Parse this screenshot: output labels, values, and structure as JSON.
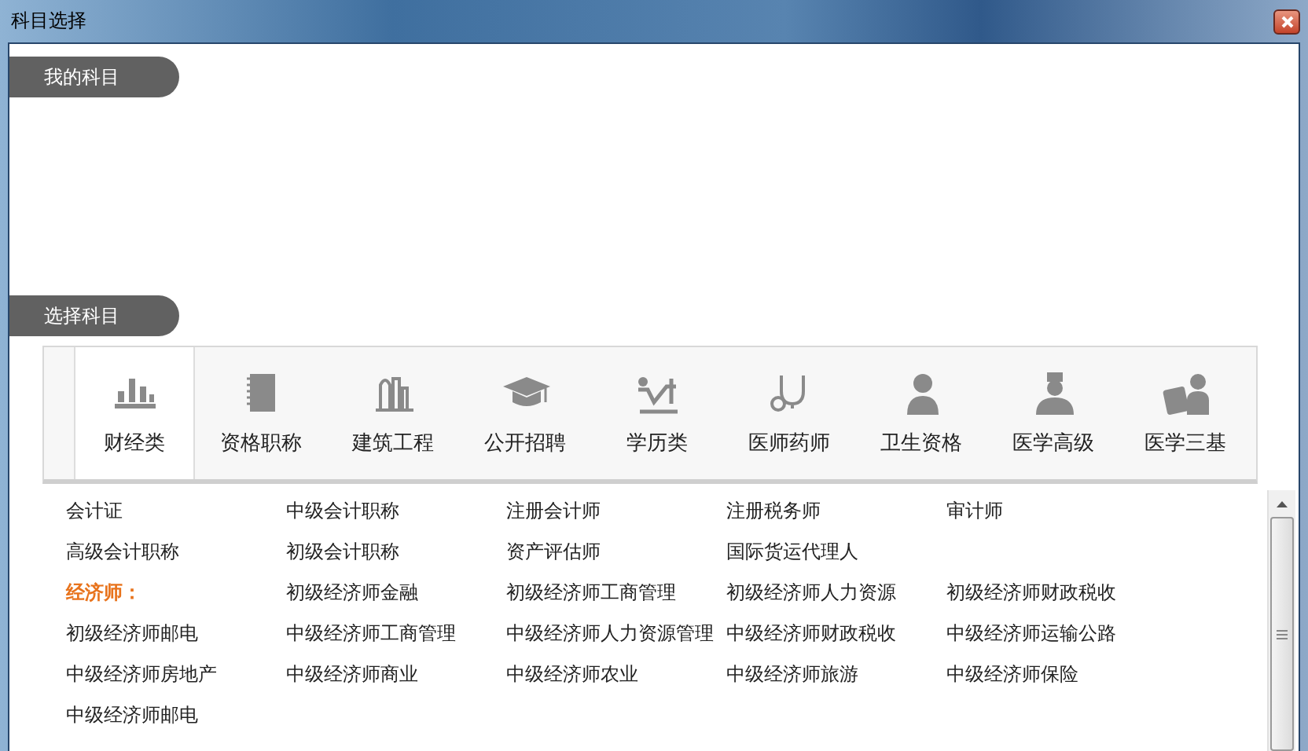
{
  "window": {
    "title": "科目选择"
  },
  "my_subjects": {
    "label": "我的科目"
  },
  "choose_subjects": {
    "label": "选择科目"
  },
  "tabs": [
    {
      "label": "财经类",
      "selected": true
    },
    {
      "label": "资格职称",
      "selected": false
    },
    {
      "label": "建筑工程",
      "selected": false
    },
    {
      "label": "公开招聘",
      "selected": false
    },
    {
      "label": "学历类",
      "selected": false
    },
    {
      "label": "医师药师",
      "selected": false
    },
    {
      "label": "卫生资格",
      "selected": false
    },
    {
      "label": "医学高级",
      "selected": false
    },
    {
      "label": "医学三基",
      "selected": false
    }
  ],
  "subjects": [
    {
      "kind": "link",
      "label": "会计证"
    },
    {
      "kind": "link",
      "label": "中级会计职称"
    },
    {
      "kind": "link",
      "label": "注册会计师"
    },
    {
      "kind": "link",
      "label": "注册税务师"
    },
    {
      "kind": "link",
      "label": "审计师"
    },
    {
      "kind": "link",
      "label": "高级会计职称"
    },
    {
      "kind": "link",
      "label": "初级会计职称"
    },
    {
      "kind": "link",
      "label": "资产评估师"
    },
    {
      "kind": "link",
      "label": "国际货运代理人"
    },
    {
      "kind": "blank"
    },
    {
      "kind": "heading",
      "label": "经济师："
    },
    {
      "kind": "link",
      "label": "初级经济师金融"
    },
    {
      "kind": "link",
      "label": "初级经济师工商管理"
    },
    {
      "kind": "link",
      "label": "初级经济师人力资源"
    },
    {
      "kind": "link",
      "label": "初级经济师财政税收"
    },
    {
      "kind": "link",
      "label": "初级经济师邮电"
    },
    {
      "kind": "link",
      "label": "中级经济师工商管理"
    },
    {
      "kind": "link",
      "label": "中级经济师人力资源管理"
    },
    {
      "kind": "link",
      "label": "中级经济师财政税收"
    },
    {
      "kind": "link",
      "label": "中级经济师运输公路"
    },
    {
      "kind": "link",
      "label": "中级经济师房地产"
    },
    {
      "kind": "link",
      "label": "中级经济师商业"
    },
    {
      "kind": "link",
      "label": "中级经济师农业"
    },
    {
      "kind": "link",
      "label": "中级经济师旅游"
    },
    {
      "kind": "link",
      "label": "中级经济师保险"
    },
    {
      "kind": "link",
      "label": "中级经济师邮电"
    }
  ]
}
